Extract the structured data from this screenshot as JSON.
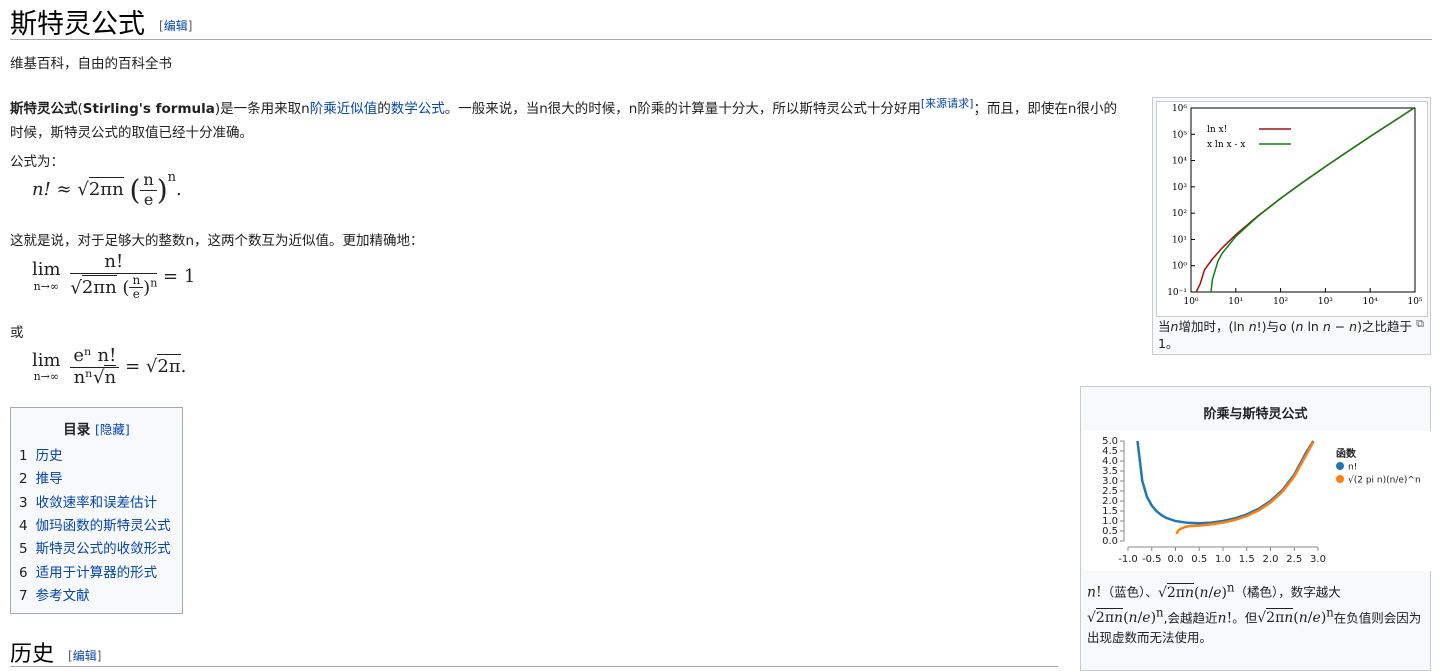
{
  "header": {
    "title": "斯特灵公式",
    "edit_label": "编辑",
    "tagline": "维基百科，自由的百科全书"
  },
  "lead": {
    "bold": "斯特灵公式",
    "bold_en": "Stirling's formula",
    "t1": "是一条用来取n",
    "link1": "阶乘",
    "link2": "近似值",
    "t2": "的",
    "link3": "数学公式",
    "t3": "。一般来说，当n很大的时候，n阶乘的计算量十分大，所以斯特灵公式十分好用",
    "cite": "[来源请求]",
    "t4": "；而且，即使在n很小的时候，斯特灵公式的取值已经十分准确。"
  },
  "body": {
    "formula_intro": "公式为：",
    "para2": "这就是说，对于足够大的整数n，这两个数互为近似值。更加精确地：",
    "or": "或"
  },
  "math": {
    "f1_lhs": "n! ≈ ",
    "f1_sqrt": "2πn",
    "f1_paren_num": "n",
    "f1_paren_den": "e",
    "f1_exp": "n",
    "f1_end": ".",
    "lim": "lim",
    "lim_sub": "n→∞",
    "f2_num": "n!",
    "f2_den_sqrt": "2πn",
    "f2_den_frac_num": "n",
    "f2_den_frac_den": "e",
    "f2_den_exp": "n",
    "f2_rhs": "= 1",
    "f3_num": "eⁿ n!",
    "f3_den": "nⁿ",
    "f3_den_sqrt": "n",
    "f3_rhs": "= ",
    "f3_rhs_sqrt": "2π",
    "f3_end": "."
  },
  "toc": {
    "title": "目录",
    "hide": "[隐藏]",
    "items": [
      {
        "num": "1",
        "label": "历史"
      },
      {
        "num": "2",
        "label": "推导"
      },
      {
        "num": "3",
        "label": "收敛速率和误差估计"
      },
      {
        "num": "4",
        "label": "伽玛函数的斯特灵公式"
      },
      {
        "num": "5",
        "label": "斯特灵公式的收敛形式"
      },
      {
        "num": "6",
        "label": "适用于计算器的形式"
      },
      {
        "num": "7",
        "label": "参考文献"
      }
    ]
  },
  "section": {
    "heading": "历史",
    "edit_label": "编辑"
  },
  "thumb1": {
    "caption_1": "当",
    "caption_n": "n",
    "caption_2": "增加时，(ln ",
    "caption_3": "!)与o (",
    "caption_4": " ln ",
    "caption_5": " − ",
    "caption_6": ")之比趋于1。",
    "legend": [
      "ln x!",
      "x ln x - x"
    ],
    "colors": {
      "lnfact": "#a01010",
      "approx": "#108010"
    }
  },
  "box2": {
    "title": "阶乘与斯特灵公式",
    "legend_title": "函数",
    "legend": [
      "n!",
      "√(2 pi n)(n/e)^n"
    ],
    "colors": {
      "fact": "#1f77b4",
      "stirling": "#ff7f0e"
    },
    "cap_blue": "（蓝色）、",
    "cap_orange": "（橘色），数字越大",
    "cap_mid": ",会越趋近",
    "cap_but": "。但",
    "cap_end": "在负值则会因为出现虚数而无法使用。"
  },
  "chart_data": [
    {
      "type": "line",
      "title": "",
      "xlabel": "",
      "ylabel": "",
      "x_scale": "log",
      "y_scale": "log",
      "xlim": [
        1,
        100000
      ],
      "ylim": [
        0.1,
        1000000
      ],
      "x_ticks": [
        "10⁰",
        "10¹",
        "10²",
        "10³",
        "10⁴",
        "10⁵"
      ],
      "y_ticks": [
        "10⁻¹",
        "10⁰",
        "10¹",
        "10²",
        "10³",
        "10⁴",
        "10⁵",
        "10⁶"
      ],
      "series": [
        {
          "name": "ln x!",
          "x": [
            1.3,
            1.6,
            2,
            3,
            5,
            10,
            30,
            100,
            300,
            1000,
            3000,
            10000,
            30000,
            100000
          ],
          "y": [
            0.1,
            0.2,
            0.7,
            1.8,
            4.8,
            15.1,
            74.7,
            363.7,
            1411,
            5912,
            21024,
            82109,
            279264,
            1051299
          ]
        },
        {
          "name": "x ln x - x",
          "x": [
            2.72,
            2.8,
            3,
            4,
            5,
            10,
            30,
            100,
            300,
            1000,
            3000,
            10000,
            30000,
            100000
          ],
          "y": [
            0.1,
            0.08,
            0.3,
            1.5,
            3.0,
            13.0,
            72.0,
            360.5,
            1411,
            5908,
            21020,
            82103,
            279264,
            1051292
          ]
        }
      ],
      "legend_position": "top-left",
      "grid": false
    },
    {
      "type": "line",
      "title": "阶乘与斯特灵公式",
      "xlim": [
        -1.0,
        3.0
      ],
      "ylim": [
        0.0,
        5.0
      ],
      "x_ticks": [
        "-1.0",
        "-0.5",
        "0.0",
        "0.5",
        "1.0",
        "1.5",
        "2.0",
        "2.5",
        "3.0"
      ],
      "y_ticks": [
        "0.0",
        "0.5",
        "1.0",
        "1.5",
        "2.0",
        "2.5",
        "3.0",
        "3.5",
        "4.0",
        "4.5",
        "5.0"
      ],
      "legend_title": "函数",
      "series": [
        {
          "name": "n!",
          "x": [
            -0.8,
            -0.7,
            -0.6,
            -0.5,
            -0.4,
            -0.3,
            -0.2,
            0,
            0.25,
            0.5,
            0.75,
            1,
            1.25,
            1.5,
            1.75,
            2,
            2.25,
            2.5,
            2.75,
            2.9
          ],
          "y": [
            5.0,
            3.0,
            2.2,
            1.77,
            1.49,
            1.3,
            1.16,
            1.0,
            0.91,
            0.89,
            0.92,
            1.0,
            1.13,
            1.33,
            1.61,
            2.0,
            2.54,
            3.32,
            4.42,
            5.0
          ]
        },
        {
          "name": "√(2 pi n)(n/e)^n",
          "x": [
            0.02,
            0.05,
            0.1,
            0.2,
            0.3,
            0.5,
            0.75,
            1,
            1.25,
            1.5,
            1.75,
            2,
            2.25,
            2.5,
            2.75,
            2.9
          ],
          "y": [
            0.35,
            0.5,
            0.6,
            0.7,
            0.75,
            0.77,
            0.83,
            0.92,
            1.05,
            1.25,
            1.53,
            1.92,
            2.46,
            3.23,
            4.3,
            4.95
          ]
        }
      ],
      "legend_position": "right"
    }
  ]
}
